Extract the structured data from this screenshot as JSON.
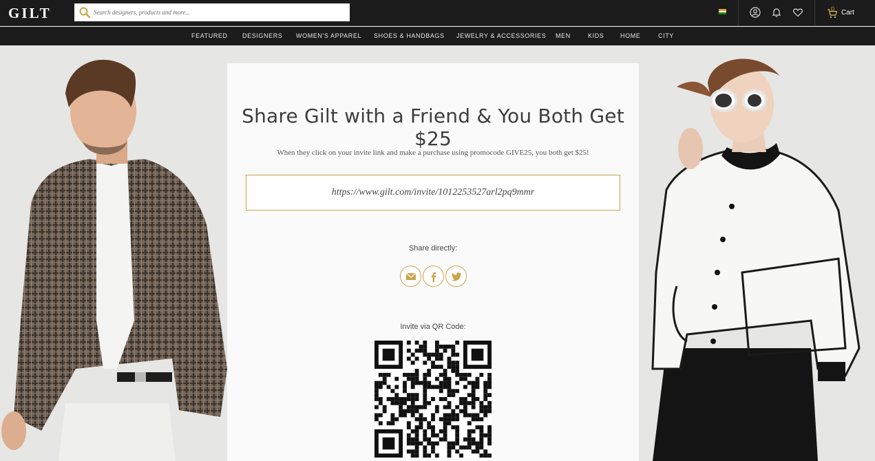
{
  "brand": {
    "logo": "GILT"
  },
  "search": {
    "placeholder": "Search designers, products and more..."
  },
  "header": {
    "cart_count": "0",
    "cart_label": "Cart"
  },
  "nav": {
    "items": [
      {
        "label": "FEATURED"
      },
      {
        "label": "DESIGNERS"
      },
      {
        "label": "WOMEN'S APPAREL"
      },
      {
        "label": "SHOES & HANDBAGS"
      },
      {
        "label": "JEWELRY & ACCESSORIES"
      },
      {
        "label": "MEN"
      },
      {
        "label": "KIDS"
      },
      {
        "label": "HOME"
      },
      {
        "label": "CITY"
      }
    ]
  },
  "invite": {
    "headline": "Share Gilt with a Friend & You Both Get $25",
    "subtext": "When they click on your invite link and make a purchase using promocode GIVE25, you both get $25!",
    "link": "https://www.gilt.com/invite/1012253527arl2pq9mmr",
    "share_label": "Share directly:",
    "share_buttons": [
      {
        "icon": "email-icon"
      },
      {
        "icon": "facebook-icon"
      },
      {
        "icon": "twitter-icon"
      }
    ],
    "qr_label": "Invite via QR Code:"
  },
  "icons": [
    "search-icon",
    "india-flag-icon",
    "account-icon",
    "bell-icon",
    "heart-icon",
    "cart-icon"
  ],
  "colors": {
    "accent": "#c9a54a",
    "topbar": "#1b1b1b",
    "panel": "#fafafa",
    "background": "#e6e6e4"
  }
}
